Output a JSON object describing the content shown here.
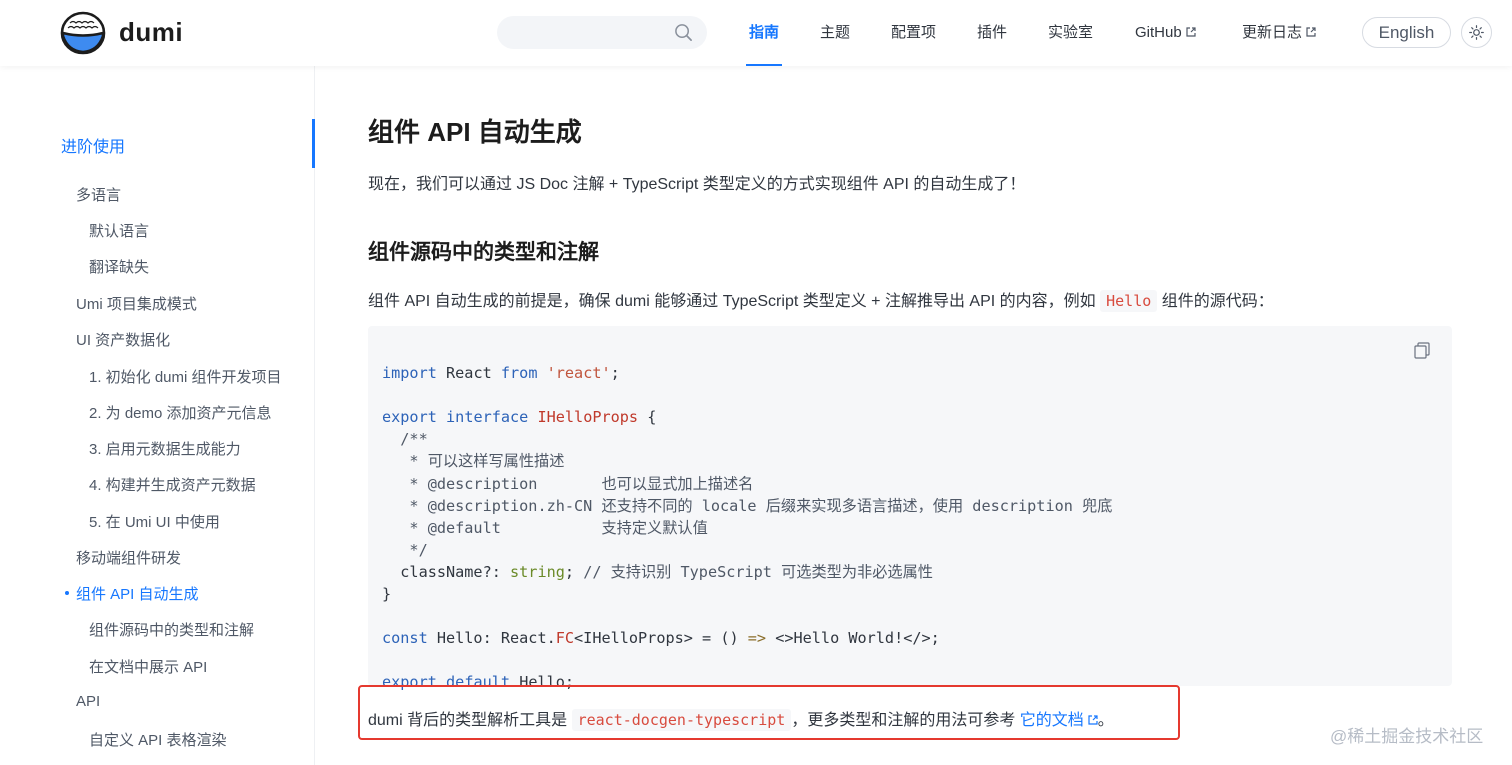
{
  "header": {
    "brand": "dumi",
    "nav": [
      {
        "label": "指南",
        "active": true
      },
      {
        "label": "主题"
      },
      {
        "label": "配置项"
      },
      {
        "label": "插件"
      },
      {
        "label": "实验室"
      },
      {
        "label": "GitHub",
        "external": true
      },
      {
        "label": "更新日志",
        "external": true
      }
    ],
    "lang_button": "English",
    "search_placeholder": ""
  },
  "sidebar": {
    "group_title": "进阶使用",
    "items": [
      {
        "label": "多语言",
        "level": 1
      },
      {
        "label": "默认语言",
        "level": 2
      },
      {
        "label": "翻译缺失",
        "level": 2
      },
      {
        "label": "Umi 项目集成模式",
        "level": 1
      },
      {
        "label": "UI 资产数据化",
        "level": 1
      },
      {
        "label": "1. 初始化 dumi 组件开发项目",
        "level": 2
      },
      {
        "label": "2. 为 demo 添加资产元信息",
        "level": 2
      },
      {
        "label": "3. 启用元数据生成能力",
        "level": 2
      },
      {
        "label": "4. 构建并生成资产元数据",
        "level": 2
      },
      {
        "label": "5. 在 Umi UI 中使用",
        "level": 2
      },
      {
        "label": "移动端组件研发",
        "level": 1
      },
      {
        "label": "组件 API 自动生成",
        "level": 1,
        "active": true
      },
      {
        "label": "组件源码中的类型和注解",
        "level": 2
      },
      {
        "label": "在文档中展示 API",
        "level": 2
      },
      {
        "label": "API",
        "level": 1
      },
      {
        "label": "自定义 API 表格渲染",
        "level": 2
      }
    ]
  },
  "content": {
    "title": "组件 API 自动生成",
    "intro": "现在，我们可以通过 JS Doc 注解 + TypeScript 类型定义的方式实现组件 API 的自动生成了！",
    "section_title": "组件源码中的类型和注解",
    "section_text_before": "组件 API 自动生成的前提是，确保 dumi 能够通过 TypeScript 类型定义 + 注解推导出 API 的内容，例如",
    "section_inline_code": "Hello",
    "section_text_after": "组件的源代码：",
    "code_lines": [
      "import React from 'react';",
      "",
      "export interface IHelloProps {",
      "  /**",
      "   * 可以这样写属性描述",
      "   * @description       也可以显式加上描述名",
      "   * @description.zh-CN 还支持不同的 locale 后缀来实现多语言描述，使用 description 兜底",
      "   * @default           支持定义默认值",
      "   */",
      "  className?: string; // 支持识别 TypeScript 可选类型为非必选属性",
      "}",
      "",
      "const Hello: React.FC<IHelloProps> = () => <>Hello World!</>;",
      "",
      "export default Hello;"
    ],
    "footer_text_before": "dumi 背后的类型解析工具是",
    "footer_inline_code": "react-docgen-typescript",
    "footer_text_middle": "，更多类型和注解的用法可参考",
    "footer_link": "它的文档",
    "footer_text_after": "。"
  },
  "watermark": "@稀土掘金技术社区",
  "colors": {
    "accent": "#1677ff",
    "highlight_border": "#e5392f",
    "code_bg": "#f6f7f9"
  }
}
